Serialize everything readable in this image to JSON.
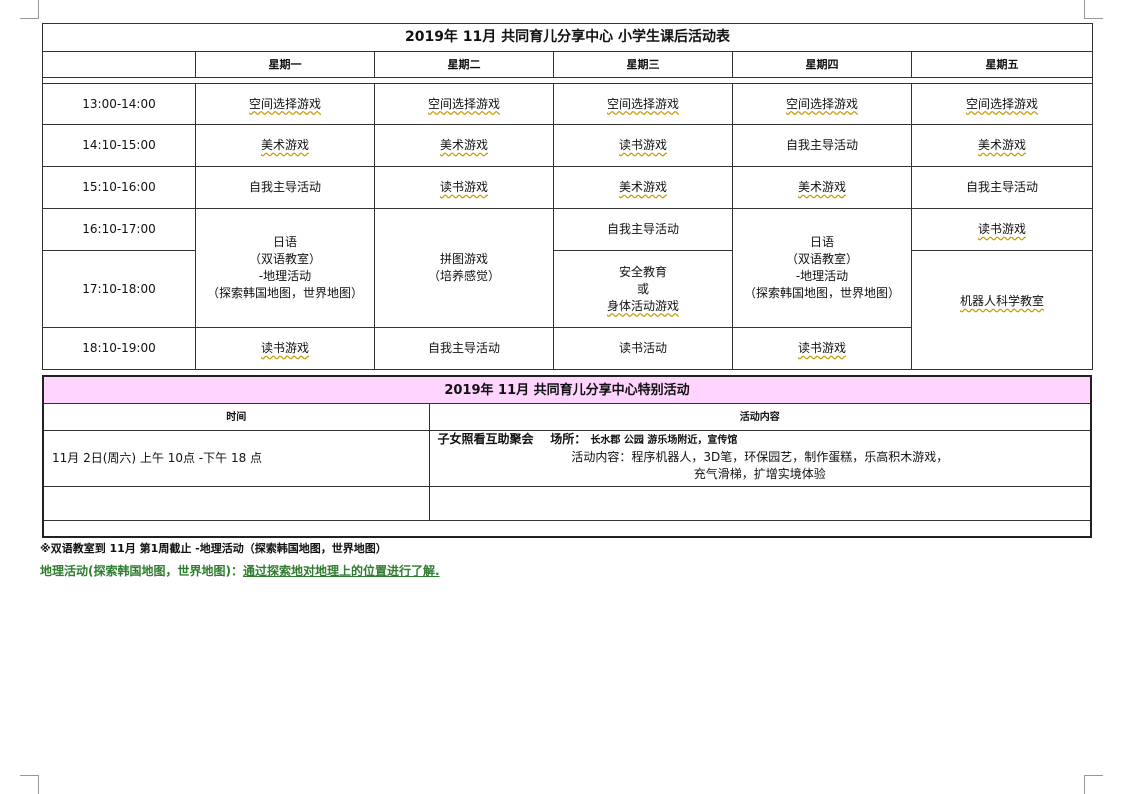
{
  "schedule": {
    "title": "2019年 11月 共同育儿分享中心   小学生课后活动表",
    "days": [
      "星期一",
      "星期二",
      "星期三",
      "星期四",
      "星期五"
    ],
    "times": [
      "13:00-14:00",
      "14:10-15:00",
      "15:10-16:00",
      "16:10-17:00",
      "17:10-18:00",
      "18:10-19:00"
    ],
    "rows": {
      "r1": [
        "空间选择游戏",
        "空间选择游戏",
        "空间选择游戏",
        "空间选择游戏",
        "空间选择游戏"
      ],
      "r2": [
        "美术游戏",
        "美术游戏",
        "读书游戏",
        "自我主导活动",
        "美术游戏"
      ],
      "r3": [
        "自我主导活动",
        "读书游戏",
        "美术游戏",
        "美术游戏",
        "自我主导活动"
      ],
      "r4_wed": "自我主导活动",
      "r4_fri": "读书游戏",
      "r6": [
        "读书游戏",
        "自我主导活动",
        "读书活动",
        "读书游戏"
      ]
    },
    "japanese": {
      "line1": "日语",
      "line2": "（双语教室）",
      "line3": "-地理活动",
      "line4": "（探索韩国地图，世界地图）"
    },
    "puzzle": {
      "line1": "拼图游戏",
      "line2": "（培养感觉）"
    },
    "safety": {
      "line1": "安全教育",
      "line2": "或",
      "line3": "身体活动游戏"
    },
    "robot": "机器人科学教室"
  },
  "special": {
    "title": "2019年 11月 共同育儿分享中心特别活动",
    "col_time": "时间",
    "col_content": "活动内容",
    "event_time": "11月 2日(周六) 上午 10点 -下午 18 点",
    "event_name": "子女照看互助聚会",
    "event_place_label": "场所：",
    "event_place": "长水郡 公园 游乐场附近，宣传馆",
    "event_content_1": "活动内容：程序机器人，3D笔，环保园艺，制作蛋糕，乐高积木游戏，",
    "event_content_2": "充气滑梯，扩增实境体验"
  },
  "notes": {
    "note1": "※双语教室到 11月 第1周截止   -地理活动（探索韩国地图，世界地图）",
    "note2_a": "地理活动(探索韩国地图，世界地图)：",
    "note2_b": "通过探索地对地理上的位置进行了解."
  }
}
